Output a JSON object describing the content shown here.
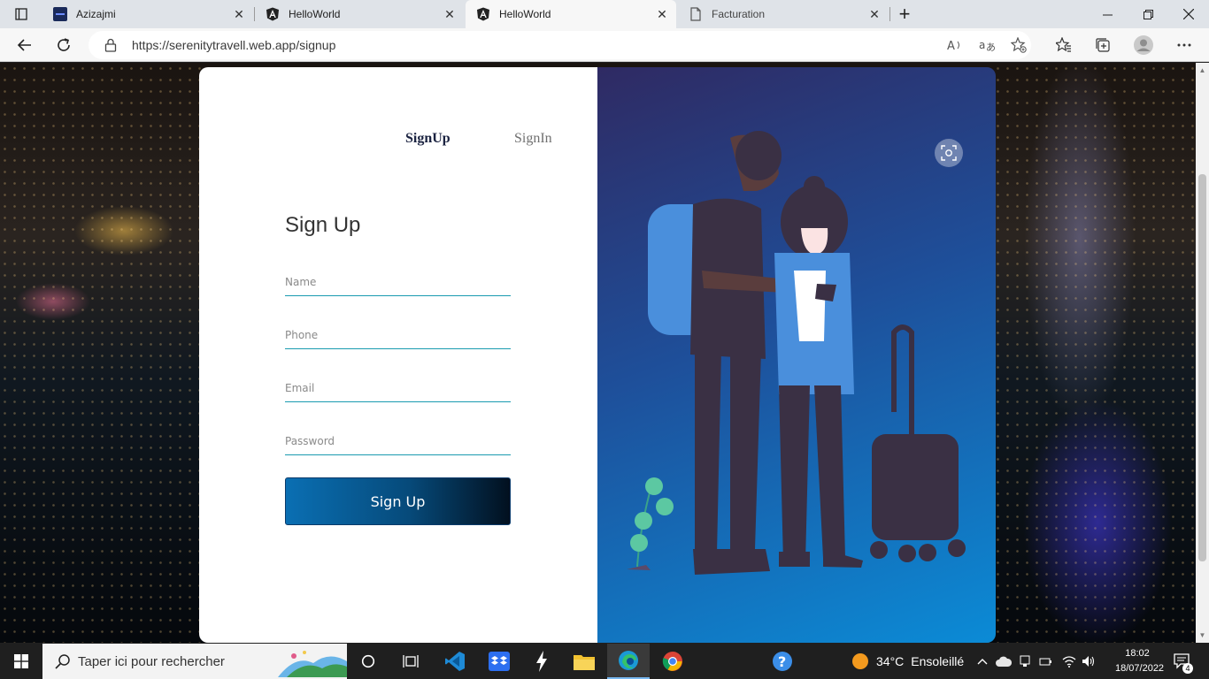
{
  "browser": {
    "tabs": [
      {
        "title": "Azizajmi",
        "favicon": "azizajmi-favicon"
      },
      {
        "title": "HelloWorld",
        "favicon": "angular-icon"
      },
      {
        "title": "HelloWorld",
        "favicon": "angular-icon",
        "active": true
      },
      {
        "title": "Facturation",
        "favicon": "document-icon"
      }
    ],
    "url": "https://serenitytravell.web.app/signup",
    "new_tab_symbol": "+"
  },
  "page": {
    "nav": {
      "signup": "SignUp",
      "signin": "SignIn"
    },
    "form": {
      "title": "Sign Up",
      "name_placeholder": "Name",
      "phone_placeholder": "Phone",
      "email_placeholder": "Email",
      "password_placeholder": "Password",
      "submit_label": "Sign Up"
    },
    "colors": {
      "accent": "#1a9bb0",
      "button_dark": "#02101f",
      "panel_top": "#2f2a63",
      "panel_bottom": "#0b8bd6"
    }
  },
  "taskbar": {
    "search_placeholder": "Taper ici pour rechercher",
    "weather_temp": "34°C",
    "weather_desc": "Ensoleillé",
    "time": "18:02",
    "date": "18/07/2022",
    "notifications": "4"
  }
}
